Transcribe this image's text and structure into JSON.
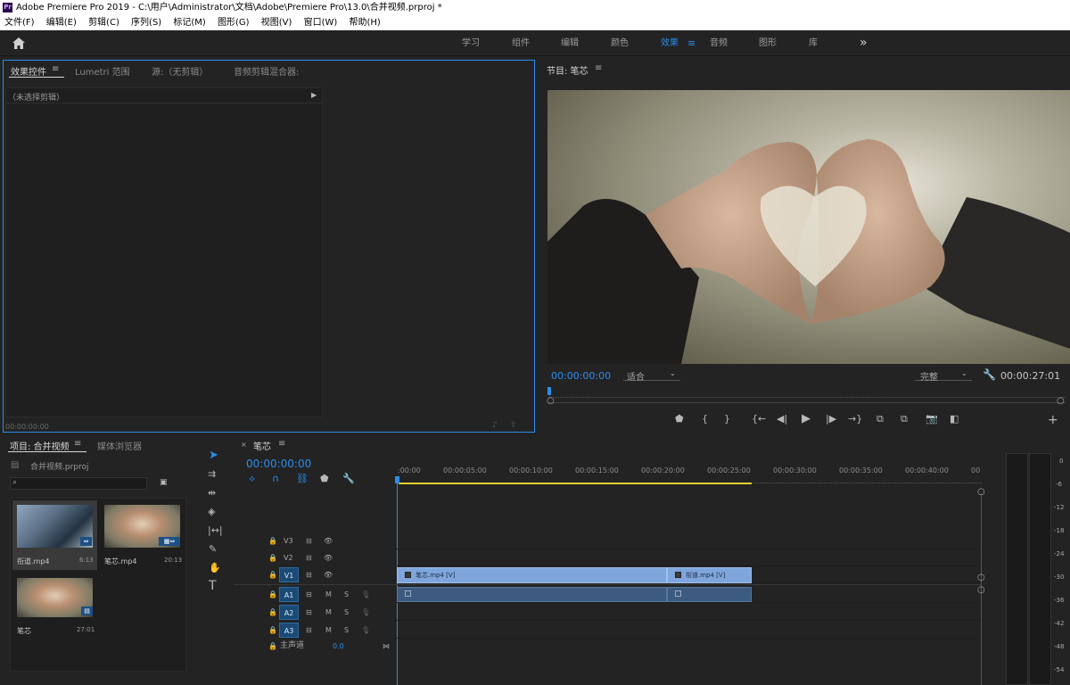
{
  "window": {
    "title": "Adobe Premiere Pro 2019 - C:\\用户\\Administrator\\文档\\Adobe\\Premiere Pro\\13.0\\合并视频.prproj *",
    "app_icon": "Pr"
  },
  "menu": [
    "文件(F)",
    "编辑(E)",
    "剪辑(C)",
    "序列(S)",
    "标记(M)",
    "图形(G)",
    "视图(V)",
    "窗口(W)",
    "帮助(H)"
  ],
  "workspaces": {
    "items": [
      "学习",
      "组件",
      "编辑",
      "颜色",
      "效果",
      "音频",
      "图形",
      "库"
    ],
    "active": "效果",
    "more": "»"
  },
  "left_panel": {
    "tabs": [
      "效果控件",
      "Lumetri 范围",
      "源:（无剪辑）",
      "音频剪辑混合器:"
    ],
    "no_clip": "（未选择剪辑）",
    "timecode": "00:00:00:00"
  },
  "program": {
    "title": "节目: 笔芯",
    "timecode": "00:00:00:00",
    "fit": "适合",
    "quality": "完整",
    "duration": "00:00:27:01",
    "playhead_fraction": 0.0
  },
  "project": {
    "tabs": [
      "项目: 合并视频",
      "媒体浏览器"
    ],
    "file": "合并视频.prproj",
    "items": [
      {
        "name": "衔道.mp4",
        "duration": "6:13"
      },
      {
        "name": "笔芯.mp4",
        "duration": "20:13"
      },
      {
        "name": "笔芯",
        "duration": "27:01"
      }
    ]
  },
  "timeline": {
    "sequence": "笔芯",
    "timecode": "00:00:00:00",
    "ruler": [
      ":00:00",
      "00:00:05:00",
      "00:00:10:00",
      "00:00:15:00",
      "00:00:20:00",
      "00:00:25:00",
      "00:00:30:00",
      "00:00:35:00",
      "00:00:40:00",
      "00"
    ],
    "tracks": {
      "video": [
        "V3",
        "V2",
        "V1"
      ],
      "audio": [
        "A1",
        "A2",
        "A3"
      ],
      "m": "M",
      "s": "S",
      "master": "主声道",
      "master_value": "0.0"
    },
    "clips": [
      {
        "name": "笔芯.mp4 [V]",
        "start": 0,
        "end": 20.4
      },
      {
        "name": "衔道.mp4 [V]",
        "start": 20.4,
        "end": 27.03
      }
    ]
  },
  "audio_meter": {
    "ticks": [
      "0",
      "-6",
      "-12",
      "-18",
      "-24",
      "-30",
      "-36",
      "-42",
      "-48",
      "-54"
    ]
  },
  "colors": {
    "accent": "#2d8ceb",
    "clip_video": "#7fa6dc",
    "clip_audio": "#3d5a80",
    "work_area": "#e3cf2a"
  }
}
